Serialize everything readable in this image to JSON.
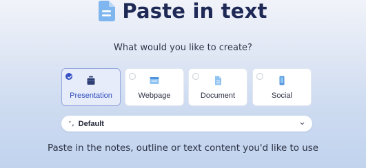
{
  "header": {
    "title": "Paste in text",
    "icon": "document-icon"
  },
  "subtitle": "What would you like to create?",
  "options": [
    {
      "label": "Presentation",
      "icon": "presentation-icon",
      "selected": true
    },
    {
      "label": "Webpage",
      "icon": "webpage-icon",
      "selected": false
    },
    {
      "label": "Document",
      "icon": "document-icon",
      "selected": false
    },
    {
      "label": "Social",
      "icon": "social-icon",
      "selected": false
    }
  ],
  "dropdown": {
    "icon": "expand-icon",
    "icon_glyph": "⸢⸥",
    "value": "Default",
    "chevron": "chevron-down-icon"
  },
  "hint": "Paste in the notes, outline or text content you'd like to use",
  "colors": {
    "accent": "#3552c4",
    "title": "#1e2a55",
    "selected_bg": "#e7ecfb"
  }
}
